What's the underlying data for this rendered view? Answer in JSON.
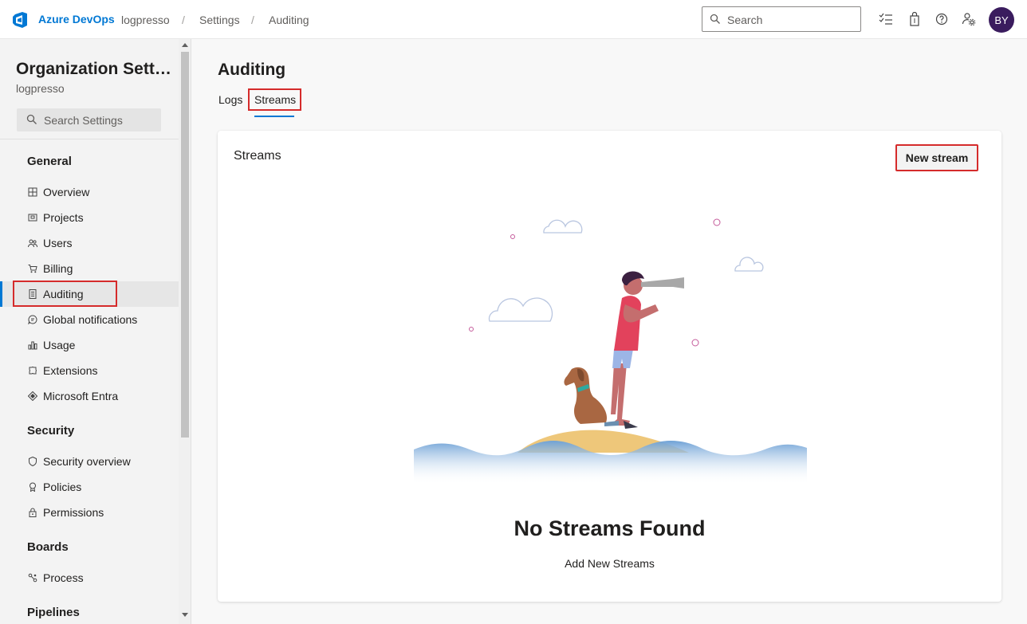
{
  "header": {
    "brand": "Azure DevOps",
    "breadcrumbs": [
      "logpresso",
      "Settings",
      "Auditing"
    ],
    "separator": "/",
    "search_placeholder": "Search",
    "avatar_initials": "BY",
    "icons": [
      "task-list-icon",
      "shopping-bag-icon",
      "help-icon",
      "user-settings-icon"
    ]
  },
  "sidebar": {
    "title": "Organization Settin...",
    "subtitle": "logpresso",
    "search_placeholder": "Search Settings",
    "sections": [
      {
        "heading": "General",
        "items": [
          {
            "label": "Overview",
            "icon": "overview-icon"
          },
          {
            "label": "Projects",
            "icon": "projects-icon"
          },
          {
            "label": "Users",
            "icon": "users-icon"
          },
          {
            "label": "Billing",
            "icon": "cart-icon"
          },
          {
            "label": "Auditing",
            "icon": "auditing-icon",
            "selected": true
          },
          {
            "label": "Global notifications",
            "icon": "notifications-icon"
          },
          {
            "label": "Usage",
            "icon": "usage-icon"
          },
          {
            "label": "Extensions",
            "icon": "extensions-icon"
          },
          {
            "label": "Microsoft Entra",
            "icon": "entra-icon"
          }
        ]
      },
      {
        "heading": "Security",
        "items": [
          {
            "label": "Security overview",
            "icon": "shield-icon"
          },
          {
            "label": "Policies",
            "icon": "policies-icon"
          },
          {
            "label": "Permissions",
            "icon": "lock-icon"
          }
        ]
      },
      {
        "heading": "Boards",
        "items": [
          {
            "label": "Process",
            "icon": "process-icon"
          }
        ]
      },
      {
        "heading": "Pipelines",
        "items": []
      }
    ]
  },
  "main": {
    "title": "Auditing",
    "tabs": [
      {
        "label": "Logs",
        "selected": false
      },
      {
        "label": "Streams",
        "selected": true
      }
    ],
    "card": {
      "title": "Streams",
      "new_button": "New stream",
      "empty_title": "No Streams Found",
      "empty_subtitle": "Add New Streams"
    }
  },
  "colors": {
    "accent": "#0078d4",
    "highlight_box": "#d52b2b",
    "avatar": "#3a1c5e"
  }
}
